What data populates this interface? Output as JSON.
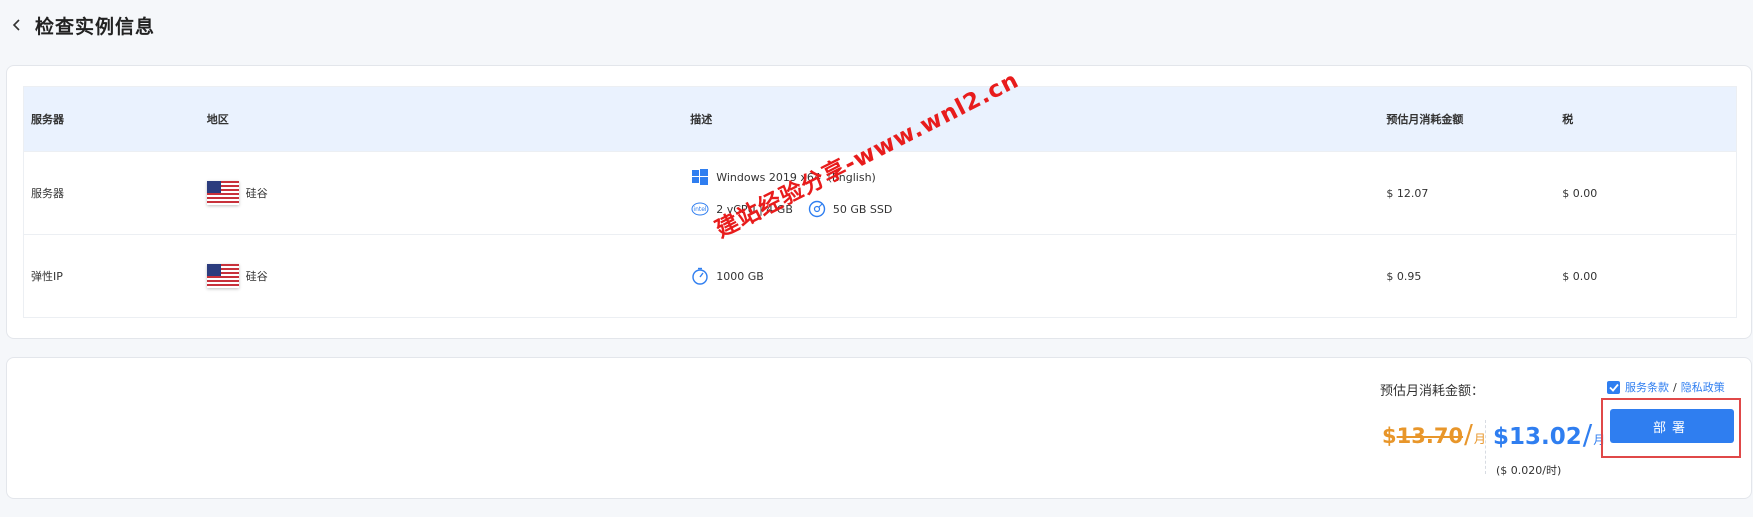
{
  "header": {
    "title": "检查实例信息"
  },
  "table": {
    "columns": [
      "服务器",
      "地区",
      "描述",
      "预估月消耗金额",
      "税"
    ],
    "rows": [
      {
        "server": "服务器",
        "region": "硅谷",
        "desc": {
          "os": "Windows 2019 x64（English)",
          "cpu_mem": "2 vCPU | 4 GB",
          "disk": "50 GB SSD"
        },
        "price": "$ 12.07",
        "tax": "$ 0.00"
      },
      {
        "server": "弹性IP",
        "region": "硅谷",
        "desc": {
          "bandwidth": "1000 GB"
        },
        "price": "$ 0.95",
        "tax": "$ 0.00"
      }
    ]
  },
  "summary": {
    "label": "预估月消耗金额：",
    "old_price": "13.70",
    "new_price": "13.02",
    "currency": "$",
    "slash": "/",
    "unit": "月",
    "hourly": "($ 0.020/时)",
    "terms_label": "服务条款",
    "terms_sep": "/",
    "privacy_label": "隐私政策",
    "terms_checked": true,
    "deploy_label": "部署"
  },
  "watermark": "建站经验分享-www.wnl2.cn",
  "colors": {
    "accent": "#2f7ef0",
    "old_price": "#e8962a",
    "highlight_border": "#e04848",
    "table_header_bg": "#eaf2fe"
  },
  "icons": {
    "back": "chevron-left-icon",
    "os": "windows-icon",
    "cpu": "cpu-icon",
    "disk": "disk-icon",
    "bandwidth": "bandwidth-icon",
    "flag": "us-flag-icon",
    "checkbox": "checkbox-checked-icon"
  }
}
